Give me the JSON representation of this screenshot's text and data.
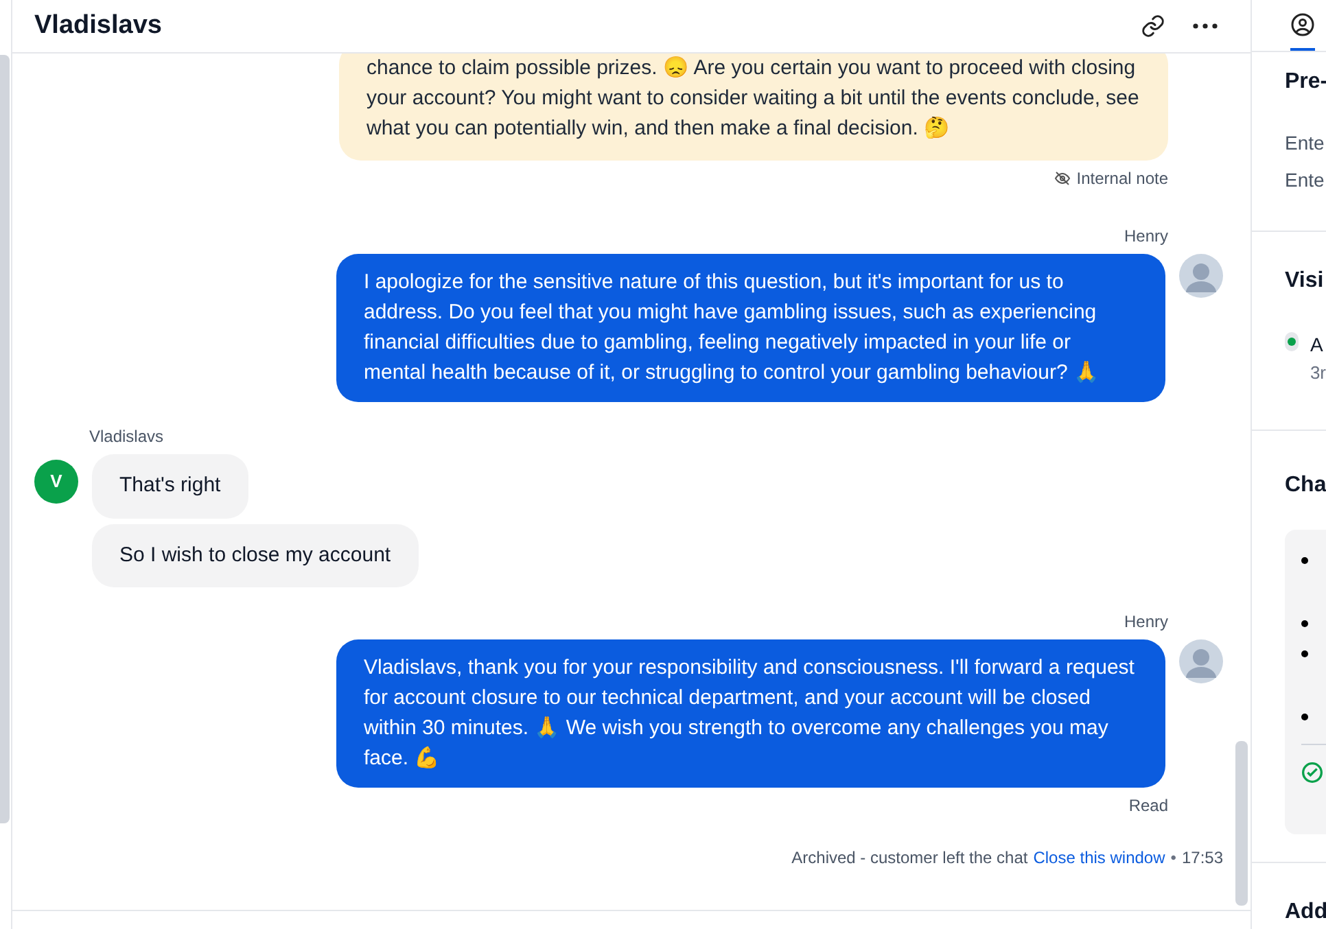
{
  "header": {
    "title": "Vladislavs"
  },
  "messages": [
    {
      "kind": "note",
      "text": "chance to claim possible prizes. 😞 Are you certain you want to proceed with closing your account? You might want to consider waiting a bit until the events conclude, see what you can potentially win, and then make a final decision. 🤔",
      "footer": "Internal note"
    },
    {
      "kind": "agent",
      "author": "Henry",
      "text": "I apologize for the sensitive nature of this question, but it's important for us to address. Do you feel that you might have gambling issues, such as experiencing financial difficulties due to gambling, feeling negatively impacted in your life or mental health because of it, or struggling to control your gambling behaviour? 🙏"
    },
    {
      "kind": "customer",
      "author": "Vladislavs",
      "initial": "V",
      "bubbles": [
        "That's right",
        "So I wish to close my account"
      ]
    },
    {
      "kind": "agent",
      "author": "Henry",
      "text": "Vladislavs, thank you for your responsibility and consciousness. I'll forward a request for account closure to our technical department, and your account will be closed within 30 minutes. 🙏 We wish you strength to overcome any challenges you may face. 💪",
      "footer": "Read"
    }
  ],
  "status": {
    "text": "Archived - customer left the chat",
    "link": "Close this window",
    "separator": "•",
    "time": "17:53"
  },
  "side": {
    "section_1": {
      "title": "Pre-",
      "lines": [
        "Ente",
        "Ente"
      ]
    },
    "section_2": {
      "title": "Visi",
      "item": "A",
      "sub": "3r"
    },
    "section_3": {
      "title": "Cha",
      "bullets": [
        {
          "kind": "long"
        },
        {
          "kind": "short"
        },
        {
          "kind": "long"
        },
        {
          "kind": "short"
        }
      ]
    },
    "section_4": {
      "title": "Add"
    }
  }
}
